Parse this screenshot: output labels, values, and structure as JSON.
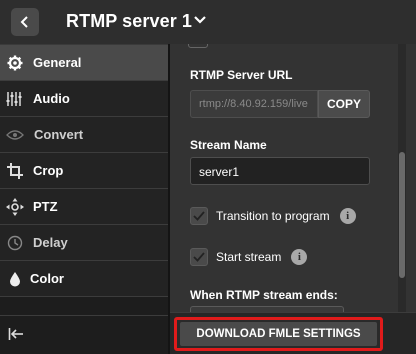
{
  "header": {
    "title": "RTMP server 1"
  },
  "sidebar": {
    "items": [
      {
        "label": "General",
        "icon": "gear-icon",
        "active": true
      },
      {
        "label": "Audio",
        "icon": "sliders-icon"
      },
      {
        "label": "Convert",
        "icon": "eye-icon"
      },
      {
        "label": "Crop",
        "icon": "crop-icon"
      },
      {
        "label": "PTZ",
        "icon": "ptz-icon"
      },
      {
        "label": "Delay",
        "icon": "clock-icon"
      },
      {
        "label": "Color",
        "icon": "droplet-icon"
      }
    ]
  },
  "settings": {
    "server_url_label": "RTMP Server URL",
    "server_url_value": "rtmp://8.40.92.159/live",
    "copy_label": "COPY",
    "stream_name_label": "Stream Name",
    "stream_name_value": "server1",
    "transition_label": "Transition to program",
    "transition_checked": true,
    "start_stream_label": "Start stream",
    "start_stream_checked": true,
    "ends_label": "When RTMP stream ends:"
  },
  "footer": {
    "download_label": "DOWNLOAD FMLE SETTINGS"
  },
  "colors": {
    "highlight": "#e01b1b",
    "active_nav": "#4a4a4a"
  }
}
